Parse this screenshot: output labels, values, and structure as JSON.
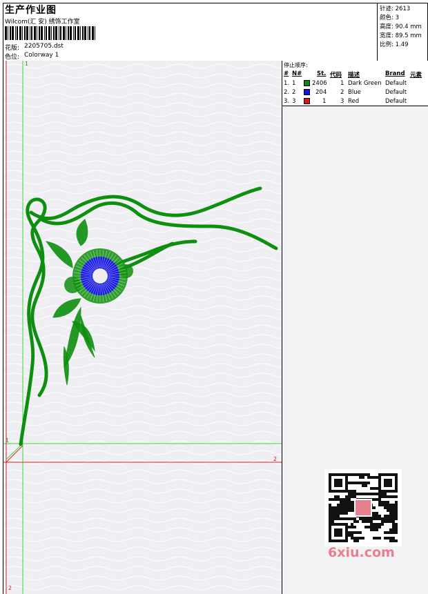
{
  "header": {
    "title": "生产作业图",
    "studio": "Wilcom(汇 安) 绣饰工作室",
    "design_label": "花版:",
    "design_file": "2205705.dst",
    "colorway_label": "色位:",
    "colorway": "Colorway 1"
  },
  "stats": [
    {
      "label": "针迹:",
      "value": "2613"
    },
    {
      "label": "颜色:",
      "value": "3"
    },
    {
      "label": "高度:",
      "value": "90.4 mm"
    },
    {
      "label": "宽度:",
      "value": "89.5 mm"
    },
    {
      "label": "比例:",
      "value": "1.49"
    }
  ],
  "stop_sequence": {
    "title": "停止顺序:",
    "headers": [
      "#",
      "N#",
      "St.",
      "代码",
      "描述",
      "Brand",
      "元素"
    ],
    "rows": [
      {
        "idx": "1.",
        "n": "1",
        "color": "#0a8a0a",
        "stitches": "2406",
        "code": "1",
        "desc": "Dark Green",
        "brand": "Default"
      },
      {
        "idx": "2.",
        "n": "2",
        "color": "#1414e0",
        "stitches": "204",
        "code": "2",
        "desc": "Blue",
        "brand": "Default"
      },
      {
        "idx": "3.",
        "n": "3",
        "color": "#e01414",
        "stitches": "1",
        "code": "3",
        "desc": "Red",
        "brand": "Default"
      }
    ]
  },
  "canvas_marks": {
    "top_marker": "1",
    "left_marker": "1",
    "right_marker": "2",
    "bottom_marker": "2"
  },
  "watermark": "6xiu.com",
  "colors": {
    "green_guide": "#33dd33",
    "red_guide": "#dd2222",
    "thread_green": "#0f8f0f",
    "thread_blue": "#1a1ae6",
    "canvas_bg": "#eeeef3"
  }
}
